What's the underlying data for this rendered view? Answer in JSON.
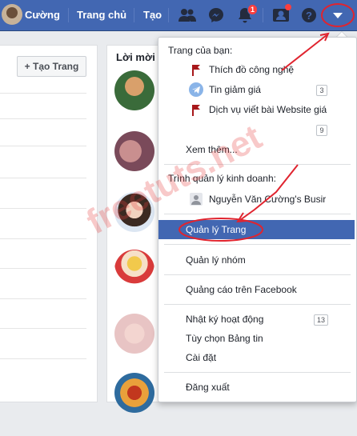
{
  "topbar": {
    "user_name": "Cường",
    "home_label": "Trang chủ",
    "create_label": "Tạo",
    "notification_count": "1",
    "bg_color": "#4267b2"
  },
  "left": {
    "create_page_label": "+ Tạo Trang"
  },
  "invites": {
    "title": "Lời mời l"
  },
  "menu": {
    "your_pages_header": "Trang của bạn:",
    "pages": [
      {
        "name": "Thích đồ công nghệ",
        "count": ""
      },
      {
        "name": "Tin giảm giá",
        "count": "3"
      },
      {
        "name": "Dịch vụ viết bài Website giá",
        "count": "9"
      }
    ],
    "see_more": "Xem thêm...",
    "business_header": "Trình quản lý kinh doanh:",
    "business_account": "Nguyễn Văn Cường's Busir",
    "manage_pages": "Quản lý Trang",
    "manage_groups": "Quản lý nhóm",
    "ads": "Quảng cáo trên Facebook",
    "activity_log": "Nhật ký hoạt động",
    "activity_count": "13",
    "news_feed_prefs": "Tùy chọn Bảng tin",
    "settings": "Cài đặt",
    "logout": "Đăng xuất"
  },
  "watermark": "freetuts.net",
  "annotation_color": "#e0242f"
}
